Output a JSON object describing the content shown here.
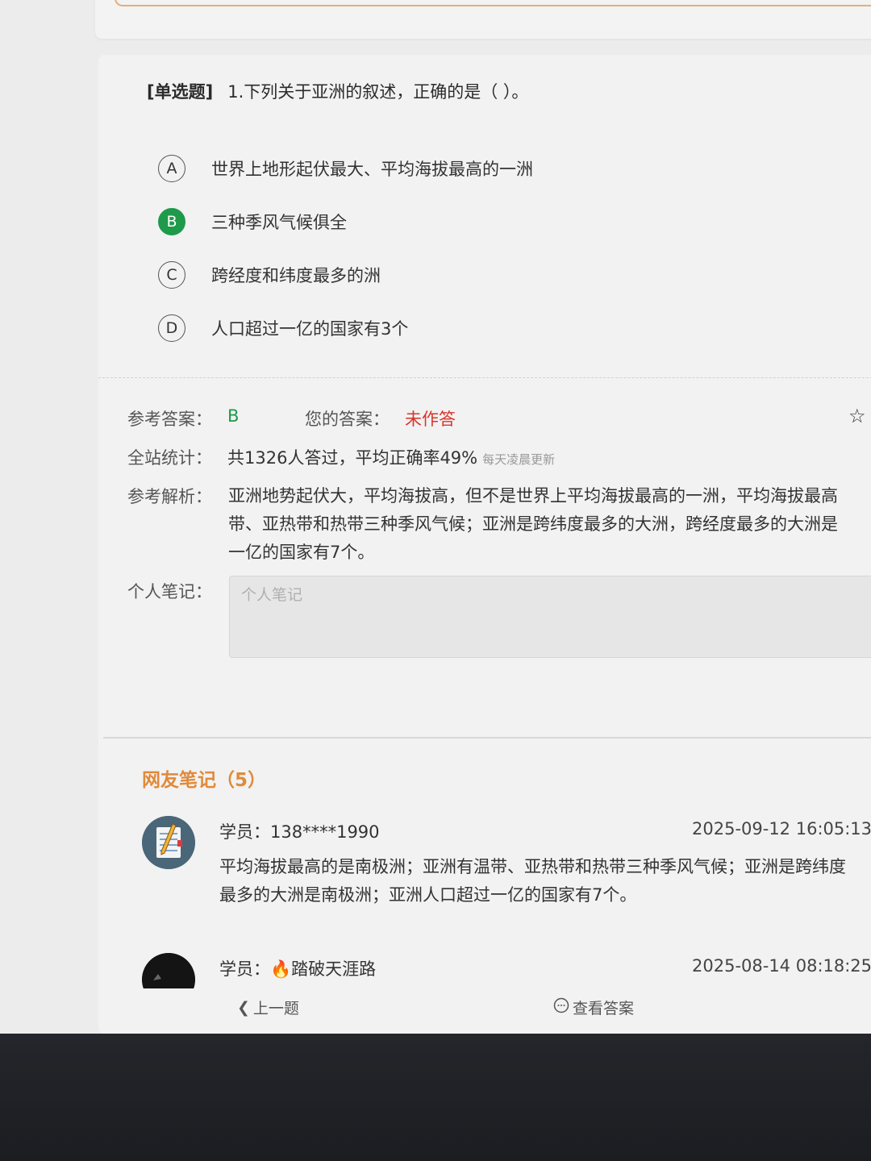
{
  "question": {
    "type_label": "[单选题]",
    "text": "1.下列关于亚洲的叙述，正确的是（   ）。"
  },
  "options": [
    {
      "letter": "A",
      "text": "世界上地形起伏最大、平均海拔最高的一洲",
      "selected": false
    },
    {
      "letter": "B",
      "text": "三种季风气候俱全",
      "selected": true
    },
    {
      "letter": "C",
      "text": "跨经度和纬度最多的洲",
      "selected": false
    },
    {
      "letter": "D",
      "text": "人口超过一亿的国家有3个",
      "selected": false
    }
  ],
  "answer": {
    "ref_label": "参考答案：",
    "ref_value": "B",
    "yours_label": "您的答案：",
    "yours_value": "未作答"
  },
  "stats": {
    "label": "全站统计：",
    "text": "共1326人答过，平均正确率49%",
    "note": "每天凌晨更新"
  },
  "analysis": {
    "label": "参考解析：",
    "lines": [
      "亚洲地势起伏大，平均海拔高，但不是世界上平均海拔最高的一洲，平均海拔最高",
      "带、亚热带和热带三种季风气候；亚洲是跨纬度最多的大洲，跨经度最多的大洲是",
      "一亿的国家有7个。"
    ]
  },
  "note": {
    "label": "个人笔记：",
    "placeholder": "个人笔记"
  },
  "community": {
    "title": "网友笔记（5）",
    "comments": [
      {
        "user": "学员：138****1990",
        "time": "2025-09-12 16:05:13",
        "lines": [
          "平均海拔最高的是南极洲；亚洲有温带、亚热带和热带三种季风气候；亚洲是跨纬度",
          "最多的大洲是南极洲；亚洲人口超过一亿的国家有7个。"
        ]
      },
      {
        "user": "学员：🔥踏破天涯路",
        "time": "2025-08-14 08:18:25",
        "lines": []
      }
    ]
  },
  "bottom": {
    "prev": "上一题",
    "view_answer": "查看答案"
  }
}
